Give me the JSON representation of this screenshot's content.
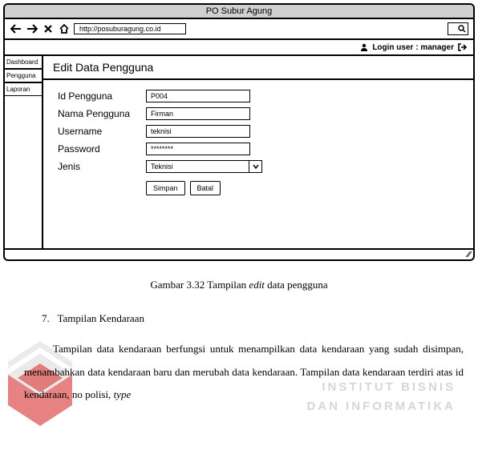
{
  "browser": {
    "title": "PO Subur Agung",
    "url": "http://posuburagung.co.id",
    "login_label": "Login user : manager"
  },
  "sidebar": {
    "items": [
      {
        "label": "Dashboard"
      },
      {
        "label": "Pengguna"
      },
      {
        "label": "Laporan"
      }
    ]
  },
  "panel": {
    "title": "Edit Data Pengguna"
  },
  "form": {
    "fields": [
      {
        "label": "Id Pengguna",
        "value": "P004"
      },
      {
        "label": "Nama Pengguna",
        "value": "Firman"
      },
      {
        "label": "Username",
        "value": "teknisi"
      },
      {
        "label": "Password",
        "value": "********"
      },
      {
        "label": "Jenis",
        "value": "Teknisi"
      }
    ],
    "buttons": {
      "save": "Simpan",
      "cancel": "Batal"
    }
  },
  "caption": {
    "prefix": "Gambar 3.32 Tampilan ",
    "italic": "edit",
    "suffix": " data pengguna"
  },
  "section": {
    "number": "7.",
    "title": "Tampilan Kendaraan"
  },
  "paragraph": {
    "seg1": "Tampilan data kendaraan berfungsi untuk menampilkan data kendaraan yang sudah disimpan, menambahkan data kendaraan baru dan merubah data kendaraan. Tampilan data kendaraan terdiri atas id kendaraan, no polisi, ",
    "italic": "type"
  },
  "watermark": {
    "line1": "INSTITUT BISNIS",
    "line2": "DAN INFORMATIKA"
  }
}
